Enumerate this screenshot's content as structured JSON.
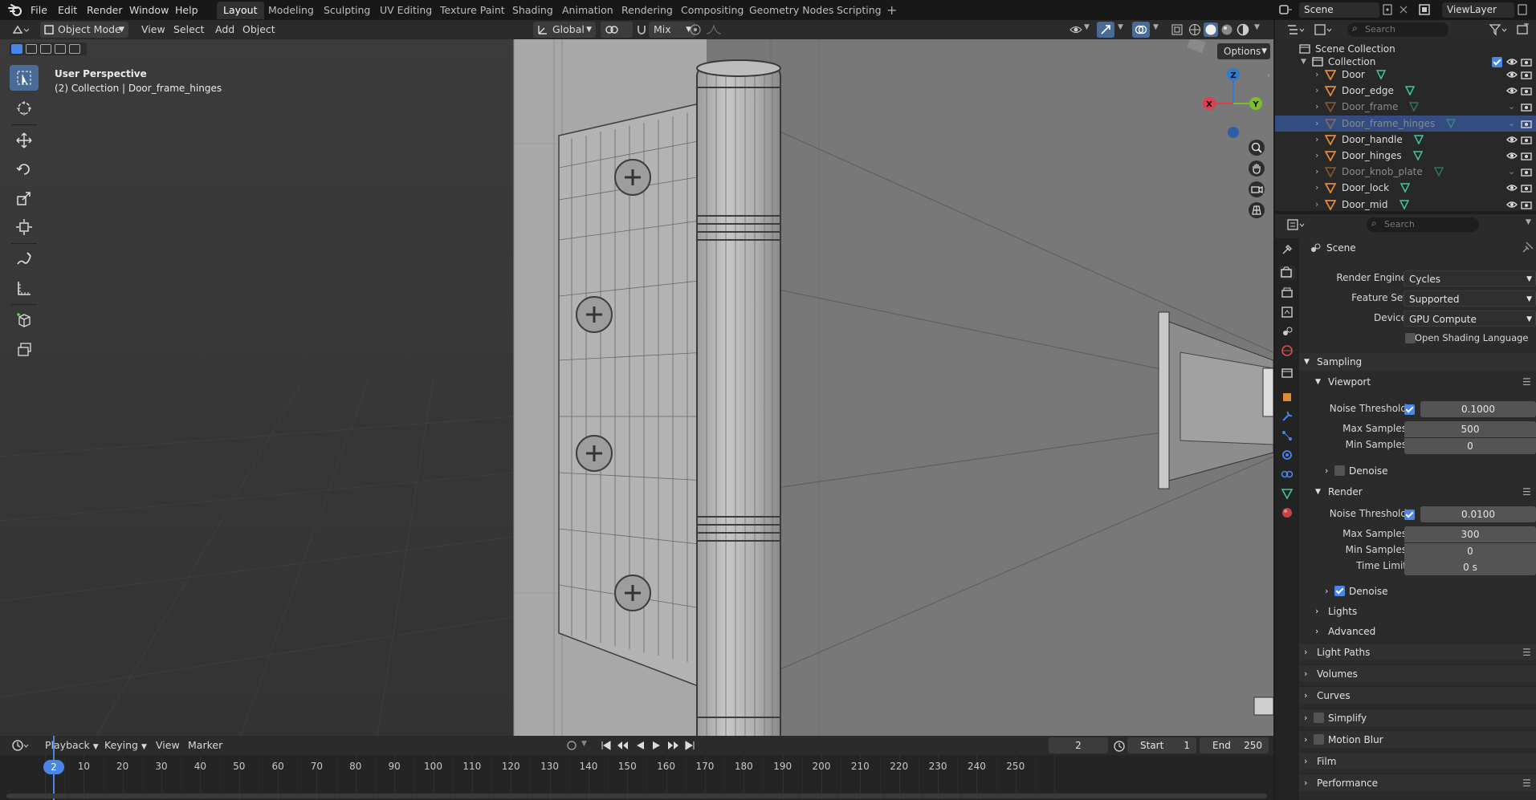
{
  "topbar": {
    "menus": [
      "File",
      "Edit",
      "Render",
      "Window",
      "Help"
    ],
    "workspaces": [
      "Layout",
      "Modeling",
      "Sculpting",
      "UV Editing",
      "Texture Paint",
      "Shading",
      "Animation",
      "Rendering",
      "Compositing",
      "Geometry Nodes",
      "Scripting"
    ],
    "active_workspace": "Layout",
    "scene": "Scene",
    "view_layer": "ViewLayer"
  },
  "viewport_header": {
    "mode": "Object Mode",
    "menus": [
      "View",
      "Select",
      "Add",
      "Object"
    ],
    "transform_orientation": "Global",
    "snap_mode": "Mix",
    "options_label": "Options"
  },
  "viewport": {
    "perspective_label": "User Perspective",
    "context_label": "(2) Collection | Door_frame_hinges",
    "gizmo_axes": [
      "X",
      "Y",
      "Z"
    ]
  },
  "timeline": {
    "menus": [
      "Playback",
      "Keying",
      "View",
      "Marker"
    ],
    "current_frame": "2",
    "start_label": "Start",
    "start": "1",
    "end_label": "End",
    "end": "250",
    "ticks": [
      "10",
      "20",
      "30",
      "40",
      "50",
      "60",
      "70",
      "80",
      "90",
      "100",
      "110",
      "120",
      "130",
      "140",
      "150",
      "160",
      "170",
      "180",
      "190",
      "200",
      "210",
      "220",
      "230",
      "240",
      "250"
    ],
    "playhead_label": "2"
  },
  "outliner": {
    "search_placeholder": "Search",
    "scene_collection": "Scene Collection",
    "collection": "Collection",
    "objects": [
      {
        "name": "Door",
        "dim": false,
        "selected": false
      },
      {
        "name": "Door_edge",
        "dim": false,
        "selected": false
      },
      {
        "name": "Door_frame",
        "dim": true,
        "selected": false
      },
      {
        "name": "Door_frame_hinges",
        "dim": true,
        "selected": true
      },
      {
        "name": "Door_handle",
        "dim": false,
        "selected": false
      },
      {
        "name": "Door_hinges",
        "dim": false,
        "selected": false
      },
      {
        "name": "Door_knob_plate",
        "dim": true,
        "selected": false
      },
      {
        "name": "Door_lock",
        "dim": false,
        "selected": false
      },
      {
        "name": "Door_mid",
        "dim": false,
        "selected": false
      }
    ]
  },
  "properties": {
    "search_placeholder": "Search",
    "context_title": "Scene",
    "render_engine_label": "Render Engine",
    "render_engine": "Cycles",
    "feature_set_label": "Feature Set",
    "feature_set": "Supported",
    "device_label": "Device",
    "device": "GPU Compute",
    "osl_label": "Open Shading Language",
    "sampling": {
      "title": "Sampling",
      "viewport": {
        "title": "Viewport",
        "noise_threshold_label": "Noise Threshold",
        "noise_threshold": "0.1000",
        "max_samples_label": "Max Samples",
        "max_samples": "500",
        "min_samples_label": "Min Samples",
        "min_samples": "0",
        "denoise_label": "Denoise"
      },
      "render": {
        "title": "Render",
        "noise_threshold_label": "Noise Threshold",
        "noise_threshold": "0.0100",
        "max_samples_label": "Max Samples",
        "max_samples": "300",
        "min_samples_label": "Min Samples",
        "min_samples": "0",
        "time_limit_label": "Time Limit",
        "time_limit": "0 s",
        "denoise_label": "Denoise"
      },
      "lights": "Lights",
      "advanced": "Advanced"
    },
    "panels": [
      "Light Paths",
      "Volumes",
      "Curves",
      "Simplify",
      "Motion Blur",
      "Film",
      "Performance"
    ]
  },
  "colors": {
    "accent": "#4a86e8",
    "selection": "#334d80",
    "axis_x": "#e53a4f",
    "axis_y": "#7bbf2b",
    "axis_z": "#2e7bd6",
    "object_icon": "#e08a3a",
    "mesh_icon": "#3fc7a0"
  }
}
